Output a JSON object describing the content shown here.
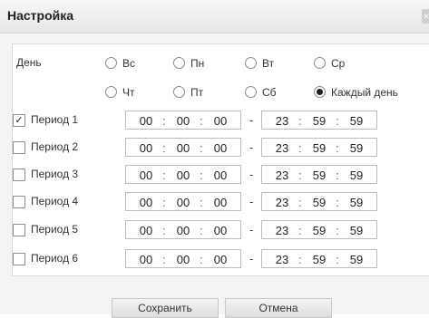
{
  "dialog": {
    "title": "Настройка",
    "close_glyph": "×"
  },
  "day_label": "День",
  "days": [
    {
      "label": "Вс",
      "checked": false
    },
    {
      "label": "Пн",
      "checked": false
    },
    {
      "label": "Вт",
      "checked": false
    },
    {
      "label": "Ср",
      "checked": false
    },
    {
      "label": "Чт",
      "checked": false
    },
    {
      "label": "Пт",
      "checked": false
    },
    {
      "label": "Сб",
      "checked": false
    },
    {
      "label": "Каждый день",
      "checked": true
    }
  ],
  "periods": [
    {
      "label": "Период 1",
      "checked": true,
      "start": [
        "00",
        "00",
        "00"
      ],
      "end": [
        "23",
        "59",
        "59"
      ]
    },
    {
      "label": "Период 2",
      "checked": false,
      "start": [
        "00",
        "00",
        "00"
      ],
      "end": [
        "23",
        "59",
        "59"
      ]
    },
    {
      "label": "Период 3",
      "checked": false,
      "start": [
        "00",
        "00",
        "00"
      ],
      "end": [
        "23",
        "59",
        "59"
      ]
    },
    {
      "label": "Период 4",
      "checked": false,
      "start": [
        "00",
        "00",
        "00"
      ],
      "end": [
        "23",
        "59",
        "59"
      ]
    },
    {
      "label": "Период 5",
      "checked": false,
      "start": [
        "00",
        "00",
        "00"
      ],
      "end": [
        "23",
        "59",
        "59"
      ]
    },
    {
      "label": "Период 6",
      "checked": false,
      "start": [
        "00",
        "00",
        "00"
      ],
      "end": [
        "23",
        "59",
        "59"
      ]
    }
  ],
  "time_separator": ":",
  "range_separator": "-",
  "checkmark": "✓",
  "buttons": {
    "save": "Сохранить",
    "cancel": "Отмена"
  }
}
